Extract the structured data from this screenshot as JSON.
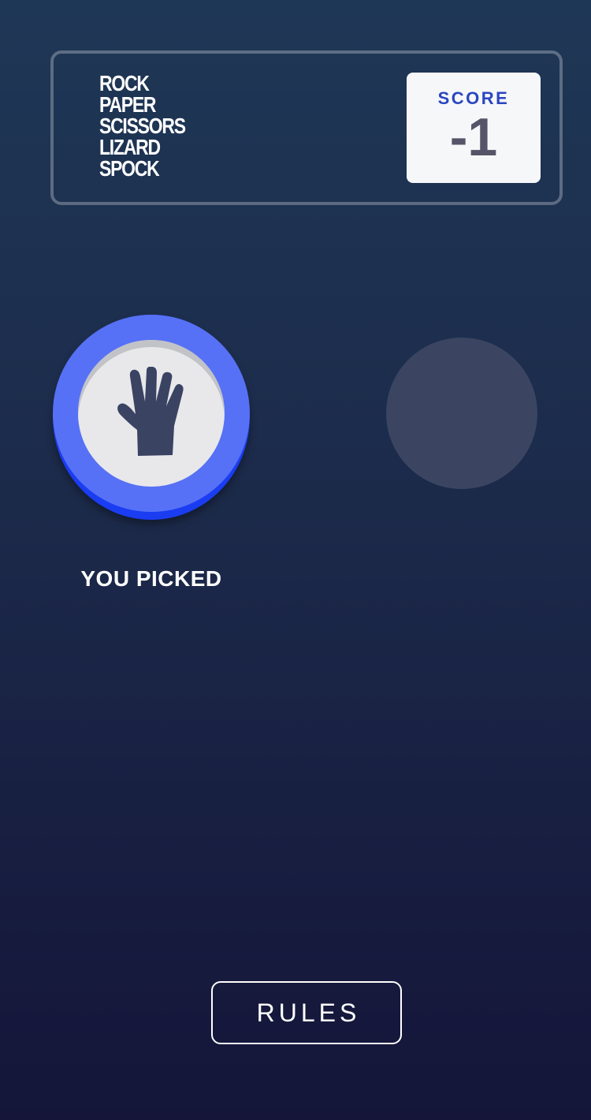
{
  "header": {
    "logo_lines": [
      "ROCK",
      "PAPER",
      "SCISSORS",
      "LIZARD",
      "SPOCK"
    ],
    "score_label": "SCORE",
    "score_value": "-1"
  },
  "game": {
    "player_choice": "paper",
    "player_choice_icon": "hand-icon",
    "player_label": "YOU PICKED",
    "colors": {
      "paper_face": "#5671f5",
      "paper_edge": "#1a3df2",
      "house_placeholder": "#3b4562"
    }
  },
  "footer": {
    "rules_label": "RULES"
  }
}
